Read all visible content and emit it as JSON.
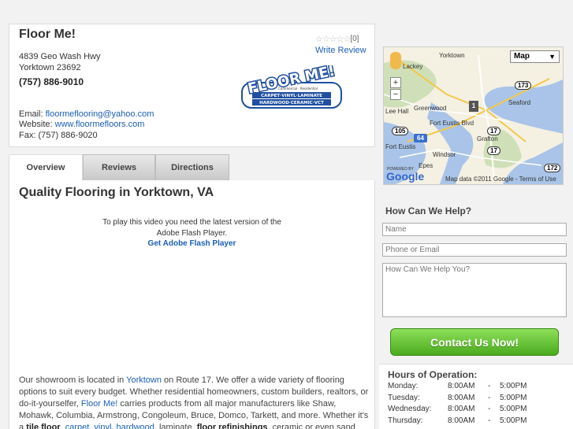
{
  "business": {
    "name": "Floor Me!",
    "address_line1": "4839 Geo Wash Hwy",
    "address_line2": "Yorktown 23692",
    "phone": "(757) 886-9010",
    "email_label": "Email:",
    "email": "floormeflooring@yahoo.com",
    "website_label": "Website:",
    "website": "www.floormefloors.com",
    "fax": "Fax: (757) 886-9020",
    "rating_count": "[0]",
    "write_review": "Write Review",
    "logo_text": "FLOOR ME!",
    "logo_sub1": "Commercial · Residential",
    "logo_sub2": "CARPET·VINYL·LAMINATE",
    "logo_sub3": "HARDWOOD·CERAMIC·VCT"
  },
  "tabs": [
    {
      "label": "Overview"
    },
    {
      "label": "Reviews"
    },
    {
      "label": "Directions"
    }
  ],
  "content": {
    "title": "Quality Flooring in Yorktown, VA",
    "flash_line1": "To play this video you need the latest version of the",
    "flash_line2": "Adobe Flash Player.",
    "flash_link": "Get Adobe Flash Player",
    "p1": "Our showroom is located in ",
    "p1_link": "Yorktown",
    "p2": " on Route 17. We offer a wide variety of flooring options to suit every budget. Whether residential homeowners, custom builders, realtors, or do-it-yourselfer, ",
    "p2_link": "Floor Me!",
    "p3": " carries products from all major manufacturers like Shaw, Mohawk, Columbia, Armstrong, Congoleum, Bruce, Domco, Tarkett, and more. Whether it's a ",
    "p3_bold": "tile floor",
    "p4": ", ",
    "p4_link1": "carpet",
    "p4_link2": "vinyl",
    "p4_link3": "hardwood",
    "p5": ", laminate, ",
    "p5_bold": "floor refinishings",
    "p6": ", ceramic or even sand and finish. Floor"
  },
  "map": {
    "type_label": "Map",
    "copyright": "Map data ©2011 Google - Terms of Use",
    "powered_by": "POWERED BY",
    "google": "Google",
    "labels": {
      "yorktown": "Yorktown",
      "lackey": "Lackey",
      "lee_hall": "Lee Hall",
      "greenwood": "Greenwood",
      "seaford": "Seaford",
      "fort_eustis": "Fort Eustis Blvd",
      "grafton": "Grafton",
      "windsor": "Windsor",
      "fort_eustis2": "Fort Eustis",
      "epes": "Epes",
      "r17a": "17",
      "r17b": "17",
      "r173": "173",
      "r105": "105",
      "r172": "172",
      "i64": "64"
    },
    "marker": "1"
  },
  "contact": {
    "title": "How Can We Help?",
    "name_placeholder": "Name",
    "phone_placeholder": "Phone or Email",
    "message_placeholder": "How Can We Help You?",
    "button": "Contact Us Now!"
  },
  "hours": {
    "title": "Hours of Operation:",
    "rows": [
      {
        "day": "Monday:",
        "open": "8:00AM",
        "dash": "-",
        "close": "5:00PM"
      },
      {
        "day": "Tuesday:",
        "open": "8:00AM",
        "dash": "-",
        "close": "5:00PM"
      },
      {
        "day": "Wednesday:",
        "open": "8:00AM",
        "dash": "-",
        "close": "5:00PM"
      },
      {
        "day": "Thursday:",
        "open": "8:00AM",
        "dash": "-",
        "close": "5:00PM"
      }
    ]
  },
  "colors": {
    "link": "#1a5fb4",
    "button_green": "#4aaa1e",
    "logo_blue": "#1f4fa0"
  }
}
